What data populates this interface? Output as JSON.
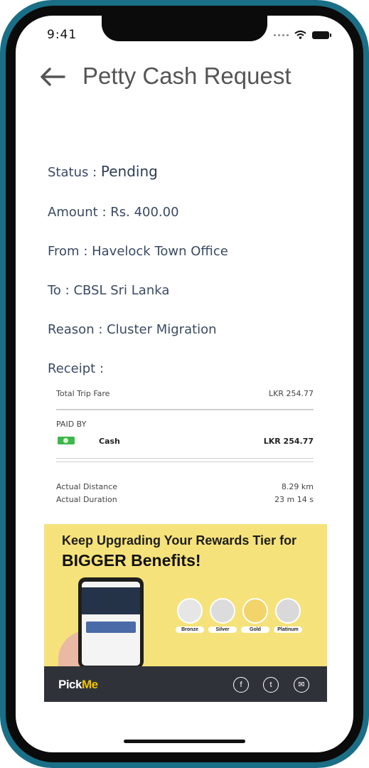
{
  "status_bar": {
    "time": "9:41"
  },
  "header": {
    "title": "Petty Cash Request"
  },
  "details": {
    "status_label": "Status : ",
    "status_value": "Pending",
    "amount_text": "Amount : Rs. 400.00",
    "from_text": "From : Havelock Town Office",
    "to_text": "To : CBSL Sri Lanka",
    "reason_text": "Reason : Cluster Migration",
    "receipt_label": "Receipt :"
  },
  "receipt": {
    "total_label": "Total Trip Fare",
    "total_value": "LKR   254.77",
    "paid_by_label": "PAID BY",
    "method": "Cash",
    "method_value": "LKR   254.77",
    "distance_label": "Actual Distance",
    "distance_value": "8.29 km",
    "duration_label": "Actual Duration",
    "duration_value": "23 m 14 s"
  },
  "banner": {
    "line1": "Keep Upgrading Your Rewards Tier for",
    "line2": "BIGGER Benefits!",
    "tiers": [
      "Bronze",
      "Silver",
      "Gold",
      "Platinum"
    ],
    "logo_main": "Pick",
    "logo_accent": "Me",
    "social": [
      "facebook-icon",
      "twitter-icon",
      "mail-icon"
    ]
  },
  "colors": {
    "frame": "#1a6f86",
    "text": "#3a4a63",
    "banner_bg": "#f6e27a",
    "cash_green": "#3db84a"
  }
}
